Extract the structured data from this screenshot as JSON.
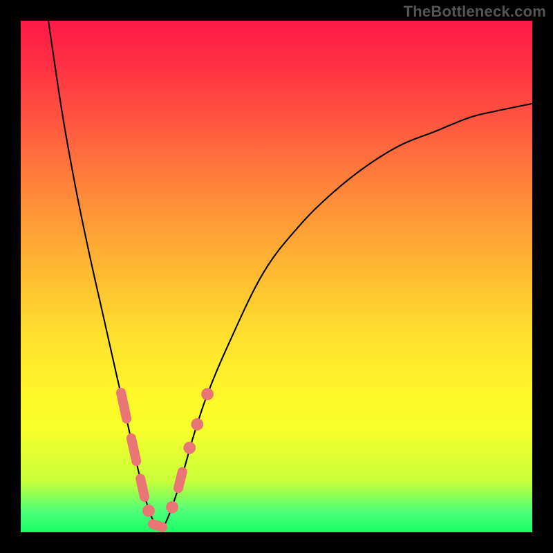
{
  "watermark": "TheBottleneck.com",
  "chart_data": {
    "type": "line",
    "title": "",
    "xlabel": "",
    "ylabel": "",
    "xlim": [
      0,
      100
    ],
    "ylim": [
      0,
      100
    ],
    "grid": false,
    "background": "red-to-green vertical gradient",
    "series": [
      {
        "name": "curve",
        "x": [
          5.4,
          8.1,
          10.8,
          13.5,
          16.2,
          18.9,
          20.3,
          21.6,
          23.0,
          24.3,
          25.7,
          27.0,
          28.4,
          31.1,
          33.8,
          36.5,
          40.5,
          47.3,
          54.1,
          60.8,
          67.6,
          74.3,
          81.1,
          87.8,
          93.2,
          100.0
        ],
        "y": [
          100.0,
          82.0,
          67.0,
          54.0,
          42.0,
          30.0,
          24.0,
          18.0,
          12.0,
          6.8,
          2.7,
          0.8,
          2.0,
          9.5,
          18.9,
          27.0,
          36.5,
          50.5,
          59.5,
          66.2,
          71.6,
          75.7,
          78.4,
          81.1,
          82.4,
          83.8
        ]
      }
    ],
    "markers": [
      {
        "shape": "capsule-diag-down",
        "x1": 19.6,
        "y1": 27.3,
        "x2": 20.7,
        "y2": 22.2
      },
      {
        "shape": "capsule-diag-down",
        "x1": 21.6,
        "y1": 18.4,
        "x2": 22.6,
        "y2": 13.9
      },
      {
        "shape": "capsule-diag-down",
        "x1": 23.4,
        "y1": 10.5,
        "x2": 24.2,
        "y2": 6.9
      },
      {
        "shape": "dot",
        "x": 25.0,
        "y": 4.2,
        "r": 1.2
      },
      {
        "shape": "capsule-horiz",
        "x1": 25.8,
        "y1": 1.6,
        "x2": 27.7,
        "y2": 1.0
      },
      {
        "shape": "dot",
        "x": 29.6,
        "y": 4.9,
        "r": 1.2
      },
      {
        "shape": "capsule-diag-up",
        "x1": 30.8,
        "y1": 8.6,
        "x2": 31.6,
        "y2": 11.8
      },
      {
        "shape": "dot",
        "x": 33.0,
        "y": 16.5,
        "r": 1.2
      },
      {
        "shape": "dot",
        "x": 34.5,
        "y": 21.1,
        "r": 1.2
      },
      {
        "shape": "dot",
        "x": 36.5,
        "y": 27.0,
        "r": 1.2
      }
    ]
  }
}
